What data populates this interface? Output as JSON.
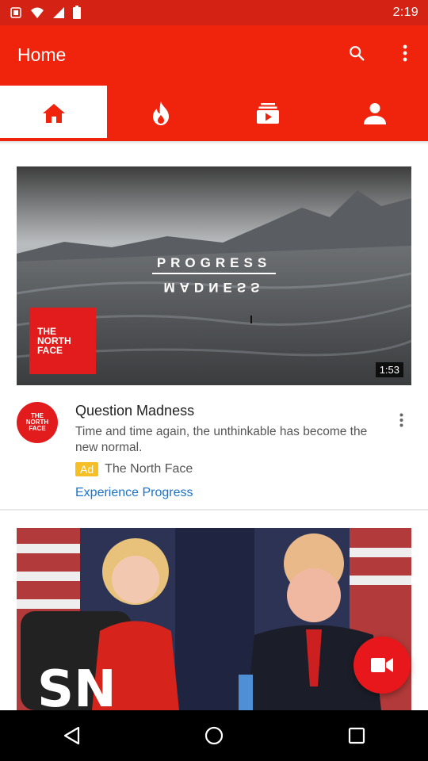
{
  "status_bar": {
    "time": "2:19",
    "icons": [
      "notification-icon",
      "wifi-icon",
      "signal-icon",
      "battery-icon"
    ]
  },
  "app_bar": {
    "title": "Home",
    "actions": [
      "search-icon",
      "more-vert-icon"
    ],
    "tabs": [
      {
        "name": "home",
        "icon": "home-icon",
        "active": true
      },
      {
        "name": "trending",
        "icon": "fire-icon",
        "active": false
      },
      {
        "name": "subscriptions",
        "icon": "subscriptions-icon",
        "active": false
      },
      {
        "name": "account",
        "icon": "person-icon",
        "active": false
      }
    ],
    "colors": {
      "bar": "#f0230c",
      "status": "#d42214",
      "active_icon": "#f0230c"
    }
  },
  "card1": {
    "video_overlay_top": "PROGRESS",
    "video_overlay_bottom": "MADNESS",
    "brand_logo": [
      "THE",
      "NORTH",
      "FACE"
    ],
    "duration": "1:53",
    "title": "Question Madness",
    "description": "Time and time again, the unthinkable has become the new normal.",
    "ad_badge": "Ad",
    "advertiser": "The North Face",
    "cta": "Experience Progress"
  },
  "card2": {
    "thumbnail_text": "SN"
  },
  "fab": {
    "icon": "videocam-icon"
  },
  "nav": {
    "buttons": [
      "back-icon",
      "home-circle-icon",
      "recents-icon"
    ]
  }
}
